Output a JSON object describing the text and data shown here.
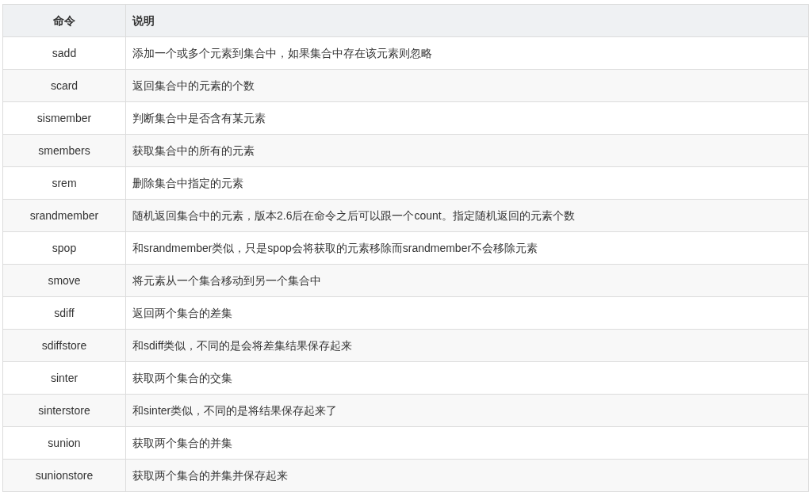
{
  "table": {
    "columns": [
      "命令",
      "说明"
    ],
    "rows": [
      [
        "sadd",
        "添加一个或多个元素到集合中，如果集合中存在该元素则忽略"
      ],
      [
        "scard",
        "返回集合中的元素的个数"
      ],
      [
        "sismember",
        "判断集合中是否含有某元素"
      ],
      [
        "smembers",
        "获取集合中的所有的元素"
      ],
      [
        "srem",
        "删除集合中指定的元素"
      ],
      [
        "srandmember",
        "随机返回集合中的元素，版本2.6后在命令之后可以跟一个count。指定随机返回的元素个数"
      ],
      [
        "spop",
        "和srandmember类似，只是spop会将获取的元素移除而srandmember不会移除元素"
      ],
      [
        "smove",
        "将元素从一个集合移动到另一个集合中"
      ],
      [
        "sdiff",
        "返回两个集合的差集"
      ],
      [
        "sdiffstore",
        "和sdiff类似，不同的是会将差集结果保存起来"
      ],
      [
        "sinter",
        "获取两个集合的交集"
      ],
      [
        "sinterstore",
        "和sinter类似，不同的是将结果保存起来了"
      ],
      [
        "sunion",
        "获取两个集合的并集"
      ],
      [
        "sunionstore",
        "获取两个集合的并集并保存起来"
      ]
    ]
  }
}
